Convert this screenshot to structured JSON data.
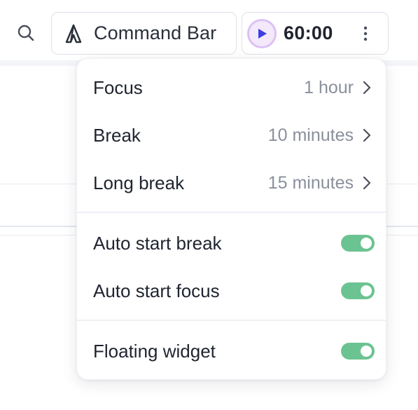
{
  "toolbar": {
    "search_icon": "search-icon",
    "command_bar": {
      "icon": "command-logo-icon",
      "label": "Command Bar"
    },
    "timer": {
      "play_icon": "play-icon",
      "time": "60:00",
      "more_icon": "more-vertical-icon"
    }
  },
  "menu": {
    "durations": [
      {
        "label": "Focus",
        "value": "1 hour"
      },
      {
        "label": "Break",
        "value": "10 minutes"
      },
      {
        "label": "Long break",
        "value": "15 minutes"
      }
    ],
    "auto_start": [
      {
        "label": "Auto start break",
        "enabled": true
      },
      {
        "label": "Auto start focus",
        "enabled": true
      }
    ],
    "widget": [
      {
        "label": "Floating widget",
        "enabled": true
      }
    ]
  },
  "colors": {
    "toggle_on": "#6cc392",
    "play_accent": "#3b3fe0",
    "play_ring": "#dcc2f3",
    "play_bg": "#f4e8fb"
  }
}
